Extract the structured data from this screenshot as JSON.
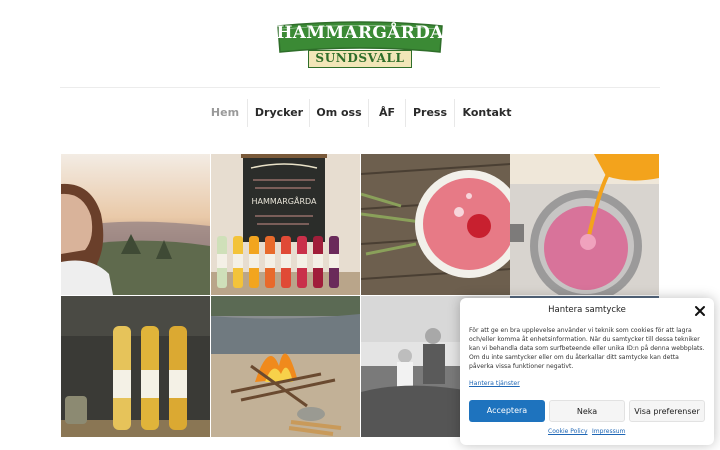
{
  "logo": {
    "top_text": "HAMMARGÅRDA",
    "bottom_text": "SUNDSVALL"
  },
  "nav": {
    "items": [
      {
        "label": "Hem",
        "active": true
      },
      {
        "label": "Drycker",
        "active": false
      },
      {
        "label": "Om oss",
        "active": false
      },
      {
        "label": "ÅF",
        "active": false
      },
      {
        "label": "Press",
        "active": false
      },
      {
        "label": "Kontakt",
        "active": false
      }
    ]
  },
  "gallery": {
    "tiles": [
      {
        "alt": "woman-in-sunset-landscape"
      },
      {
        "alt": "lemonade-bottles-with-chalkboard"
      },
      {
        "alt": "pink-cream-dessert"
      },
      {
        "alt": "juice-pouring-into-pot"
      },
      {
        "alt": "three-cider-bottles"
      },
      {
        "alt": "campfire-by-lake"
      },
      {
        "alt": "vintage-children-photo"
      },
      {
        "alt": "dark-photo"
      }
    ],
    "chalkboard_text": "HAMMARGÅRDA"
  },
  "consent": {
    "title": "Hantera samtycke",
    "body": "För att ge en bra upplevelse använder vi teknik som cookies för att lagra och/eller komma åt enhetsinformation. När du samtycker till dessa tekniker kan vi behandla data som surfbeteende eller unika ID:n på denna webbplats. Om du inte samtycker eller om du återkallar ditt samtycke kan detta påverka vissa funktioner negativt.",
    "manage_link": "Hantera tjänster",
    "accept_label": "Acceptera",
    "deny_label": "Neka",
    "prefs_label": "Visa preferenser",
    "cookie_policy_label": "Cookie Policy",
    "impressum_label": "Impressum"
  },
  "colors": {
    "logo_green": "#3b8a35",
    "logo_dark_green": "#2f6e2a",
    "logo_cream": "#f2e6b8",
    "accent_blue": "#1e73be"
  }
}
